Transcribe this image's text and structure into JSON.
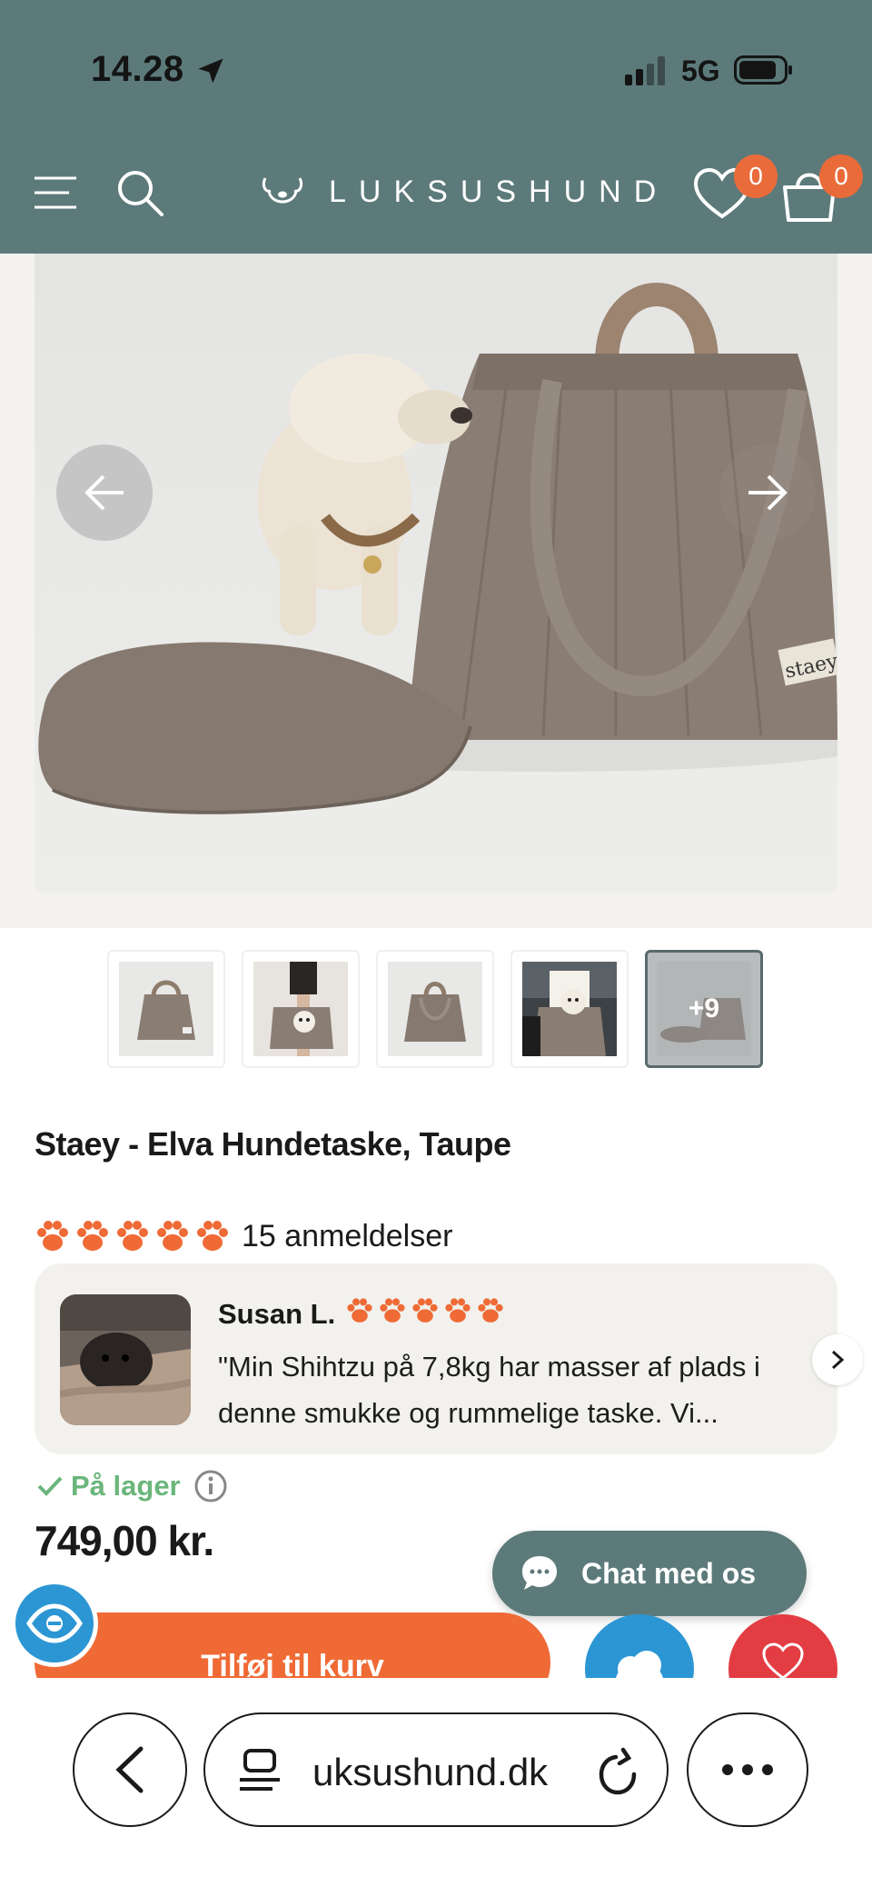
{
  "status_bar": {
    "time": "14.28",
    "network": "5G"
  },
  "header": {
    "brand": "LUKSUSHUND",
    "wishlist_count": "0",
    "cart_count": "0",
    "colors": {
      "header_bg": "#5d7a7b",
      "badge": "#ea6b3a"
    }
  },
  "gallery": {
    "thumbnails": [
      {
        "alt": "bag front"
      },
      {
        "alt": "bag carried with dog"
      },
      {
        "alt": "bag side"
      },
      {
        "alt": "bag on lap"
      },
      {
        "alt": "more images",
        "overlay": "+9"
      }
    ]
  },
  "product": {
    "title": "Staey - Elva Hundetaske, Taupe",
    "reviews_label": "15 anmeldelser",
    "rating": 5,
    "stock_label": "På lager",
    "price": "749,00 kr."
  },
  "review": {
    "author": "Susan L.",
    "rating": 5,
    "text": "\"Min Shihtzu på 7,8kg har masser af plads i denne smukke og rummelige taske. Vi..."
  },
  "chat": {
    "label": "Chat med os"
  },
  "actions": {
    "add_to_cart": "Tilføj til kurv"
  },
  "browser": {
    "url": "uksushund.dk"
  }
}
